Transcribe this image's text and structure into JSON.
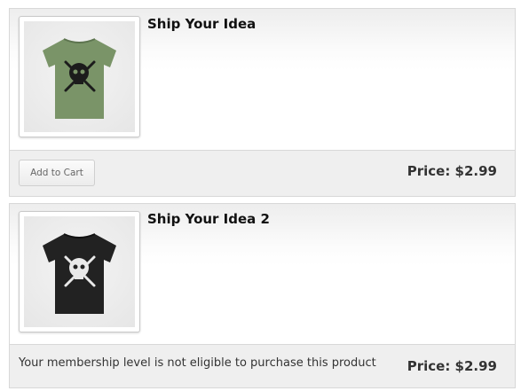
{
  "products": [
    {
      "title": "Ship Your Idea",
      "shirt_color": "#7a9468",
      "price_label": "Price: $2.99",
      "action_label": "Add to Cart"
    },
    {
      "title": "Ship Your Idea 2",
      "shirt_color": "#222222",
      "price_label": "Price: $2.99",
      "notice": "Your membership level is not eligible to purchase this product"
    }
  ]
}
